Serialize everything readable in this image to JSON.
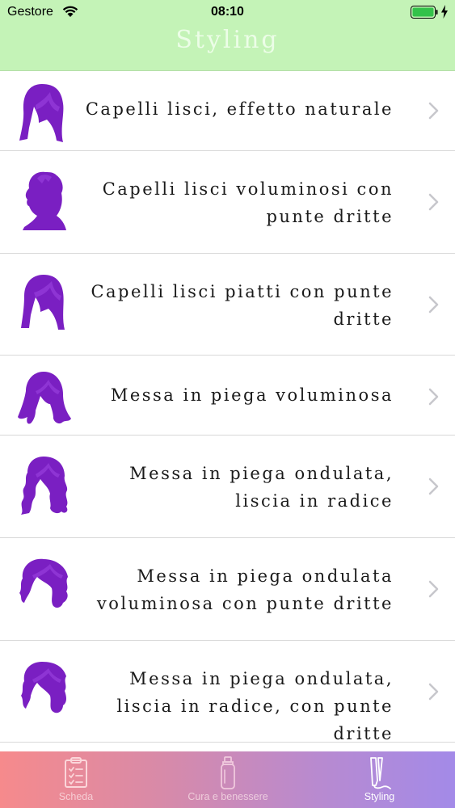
{
  "status_bar": {
    "carrier": "Gestore",
    "time": "08:10"
  },
  "header": {
    "title": "Styling"
  },
  "items": [
    {
      "label": "Capelli lisci, effetto naturale",
      "icon": "hair-straight-natural-icon"
    },
    {
      "label": "Capelli lisci voluminosi con punte dritte",
      "icon": "hair-short-profile-icon"
    },
    {
      "label": "Capelli lisci piatti con punte dritte",
      "icon": "hair-straight-flat-icon"
    },
    {
      "label": "Messa in piega voluminosa",
      "icon": "hair-voluminous-icon"
    },
    {
      "label": "Messa in piega ondulata, liscia in radice",
      "icon": "hair-wavy-long-icon"
    },
    {
      "label": "Messa in piega ondulata voluminosa con punte dritte",
      "icon": "hair-wavy-voluminous-icon"
    },
    {
      "label": "Messa in piega ondulata, liscia in radice, con punte dritte",
      "icon": "hair-wavy-short-icon"
    }
  ],
  "tabs": [
    {
      "label": "Scheda",
      "icon": "clipboard-icon",
      "active": false
    },
    {
      "label": "Cura e benessere",
      "icon": "spray-bottle-icon",
      "active": false
    },
    {
      "label": "Styling",
      "icon": "hair-straightener-icon",
      "active": true
    }
  ],
  "colors": {
    "header_bg": "#c4f3b7",
    "icon_purple": "#7a1fc2",
    "tabbar_gradient_start": "#f68a8c",
    "tabbar_gradient_end": "#a38ae8"
  }
}
